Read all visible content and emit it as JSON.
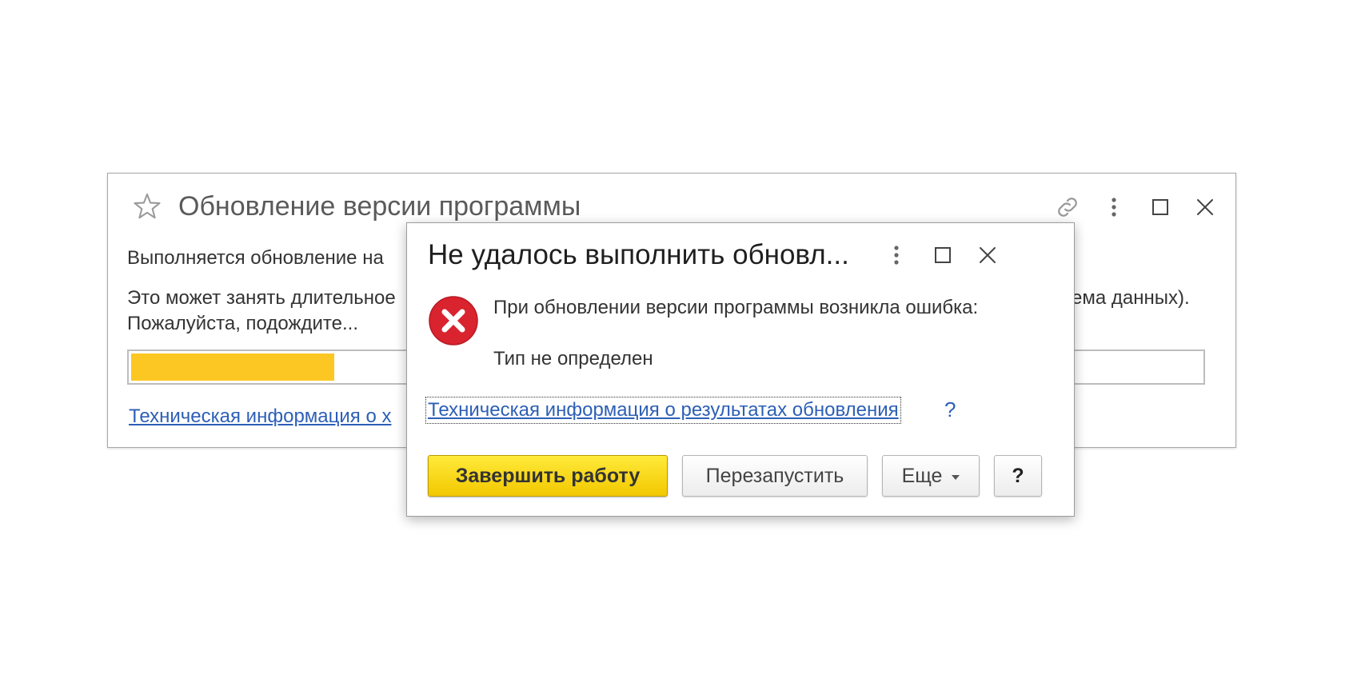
{
  "background_window": {
    "title": "Обновление версии программы",
    "status_text": "Выполняется обновление на",
    "wait_text_line1": "Это может занять длительное",
    "wait_text_tail": "ема данных).",
    "wait_text_line2": "Пожалуйста, подождите...",
    "progress_fraction": 0.19,
    "progress_color": "#fcc722",
    "tech_link": "Техническая информация о х",
    "icons": [
      "star-icon",
      "link-icon",
      "kebab-menu-icon",
      "maximize-icon",
      "close-icon"
    ]
  },
  "dialog": {
    "title": "Не удалось выполнить обновл...",
    "message": "При обновлении версии программы возникла ошибка:",
    "detail": "Тип не определен",
    "tech_link": "Техническая информация о результатах обновления",
    "tech_link_help": "?",
    "buttons": {
      "finish": "Завершить работу",
      "restart": "Перезапустить",
      "more": "Еще",
      "help": "?"
    },
    "icons": [
      "error-icon",
      "kebab-menu-icon",
      "maximize-icon",
      "close-icon"
    ],
    "colors": {
      "primary_button": "#f7d400",
      "error": "#d9232e",
      "link": "#2d5fb6"
    }
  }
}
